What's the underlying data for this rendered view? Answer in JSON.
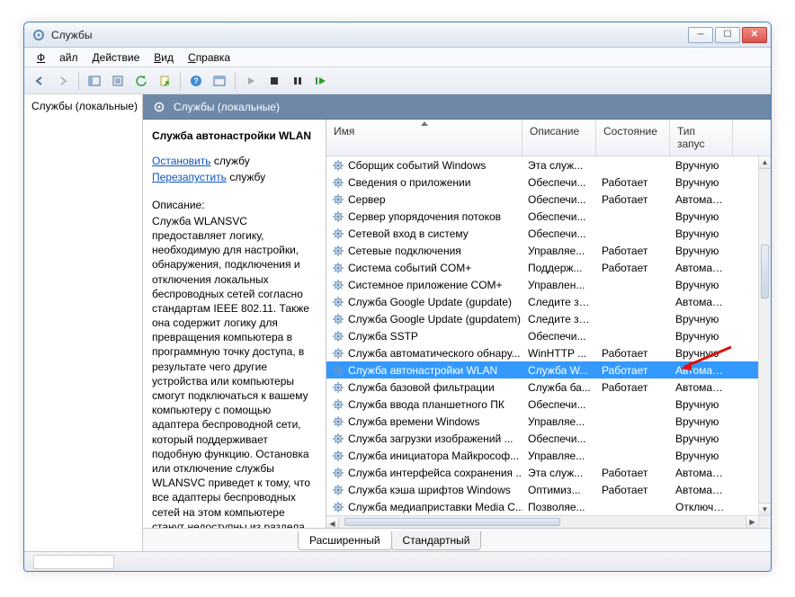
{
  "window": {
    "title": "Службы"
  },
  "menu": {
    "file": "Файл",
    "action": "Действие",
    "view": "Вид",
    "help": "Справка"
  },
  "tree": {
    "root": "Службы (локальные)"
  },
  "header": {
    "title": "Службы (локальные)"
  },
  "detail": {
    "title": "Служба автонастройки WLAN",
    "stop_link": "Остановить",
    "stop_suffix": " службу",
    "restart_link": "Перезапустить",
    "restart_suffix": " службу",
    "desc_label": "Описание:",
    "desc_text": "Служба WLANSVC предоставляет логику, необходимую для настройки, обнаружения, подключения и отключения локальных беспроводных сетей согласно стандартам IEEE 802.11. Также она содержит логику для превращения компьютера в программную точку доступа, в результате чего другие устройства или компьютеры смогут подключаться к вашему компьютеру с помощью адаптера беспроводной сети, который поддерживает подобную функцию. Остановка или отключение службы WLANSVC приведет к тому, что все адаптеры беспроводных сетей на этом компьютере станут недоступны из раздела"
  },
  "columns": {
    "name": "Имя",
    "desc": "Описание",
    "state": "Состояние",
    "startup": "Тип запус"
  },
  "rows": [
    {
      "name": "Сборщик событий Windows",
      "desc": "Эта служ...",
      "state": "",
      "startup": "Вручную"
    },
    {
      "name": "Сведения о приложении",
      "desc": "Обеспечи...",
      "state": "Работает",
      "startup": "Вручную"
    },
    {
      "name": "Сервер",
      "desc": "Обеспечи...",
      "state": "Работает",
      "startup": "Автомати..."
    },
    {
      "name": "Сервер упорядочения потоков",
      "desc": "Обеспечи...",
      "state": "",
      "startup": "Вручную"
    },
    {
      "name": "Сетевой вход в систему",
      "desc": "Обеспечи...",
      "state": "",
      "startup": "Вручную"
    },
    {
      "name": "Сетевые подключения",
      "desc": "Управляе...",
      "state": "Работает",
      "startup": "Вручную"
    },
    {
      "name": "Система событий COM+",
      "desc": "Поддерж...",
      "state": "Работает",
      "startup": "Автомати..."
    },
    {
      "name": "Системное приложение COM+",
      "desc": "Управлен...",
      "state": "",
      "startup": "Вручную"
    },
    {
      "name": "Служба Google Update (gupdate)",
      "desc": "Следите за...",
      "state": "",
      "startup": "Автомати..."
    },
    {
      "name": "Служба Google Update (gupdatem)",
      "desc": "Следите за...",
      "state": "",
      "startup": "Вручную"
    },
    {
      "name": "Служба SSTP",
      "desc": "Обеспечи...",
      "state": "",
      "startup": "Вручную"
    },
    {
      "name": "Служба автоматического обнару...",
      "desc": "WinHTTP ...",
      "state": "Работает",
      "startup": "Вручную"
    },
    {
      "name": "Служба автонастройки WLAN",
      "desc": "Служба W...",
      "state": "Работает",
      "startup": "Автомати...",
      "selected": true
    },
    {
      "name": "Служба базовой фильтрации",
      "desc": "Служба ба...",
      "state": "Работает",
      "startup": "Автомати..."
    },
    {
      "name": "Служба ввода планшетного ПК",
      "desc": "Обеспечи...",
      "state": "",
      "startup": "Вручную"
    },
    {
      "name": "Служба времени Windows",
      "desc": "Управляе...",
      "state": "",
      "startup": "Вручную"
    },
    {
      "name": "Служба загрузки изображений ...",
      "desc": "Обеспечи...",
      "state": "",
      "startup": "Вручную"
    },
    {
      "name": "Служба инициатора Майкрософ...",
      "desc": "Управляе...",
      "state": "",
      "startup": "Вручную"
    },
    {
      "name": "Служба интерфейса сохранения ...",
      "desc": "Эта служ...",
      "state": "Работает",
      "startup": "Автомати..."
    },
    {
      "name": "Служба кэша шрифтов Windows",
      "desc": "Оптимиз...",
      "state": "Работает",
      "startup": "Автомати..."
    },
    {
      "name": "Служба медиаприставки Media C...",
      "desc": "Позволяе...",
      "state": "",
      "startup": "Отключе..."
    }
  ],
  "tabs": {
    "extended": "Расширенный",
    "standard": "Стандартный"
  }
}
